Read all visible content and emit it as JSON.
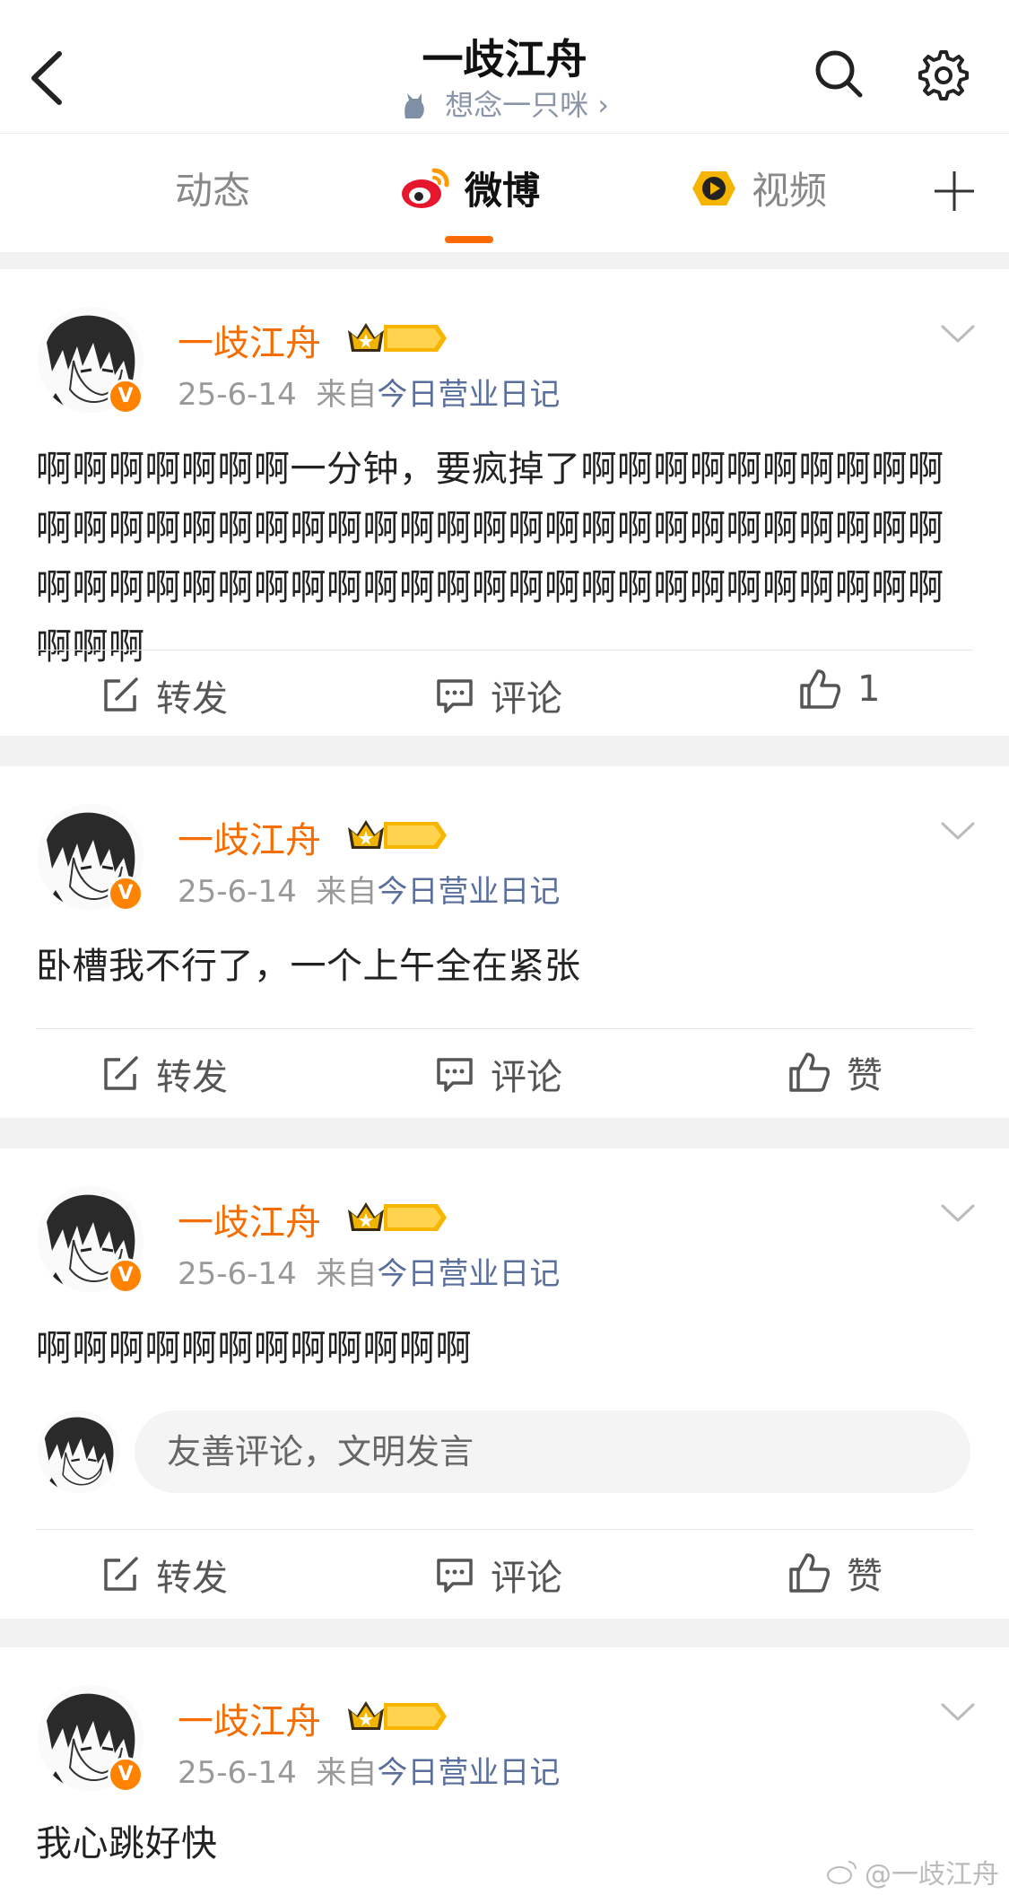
{
  "header": {
    "title": "一歧江舟",
    "subtitle": "想念一只咪 ›"
  },
  "tabs": [
    {
      "label": "动态"
    },
    {
      "label": "微博"
    },
    {
      "label": "视频"
    }
  ],
  "posts": [
    {
      "username": "一歧江舟",
      "date": "25-6-14",
      "from": "来自",
      "source": "今日营业日记",
      "text": "啊啊啊啊啊啊啊一分钟，要疯掉了啊啊啊啊啊啊啊啊啊啊啊啊啊啊啊啊啊啊啊啊啊啊啊啊啊啊啊啊啊啊啊啊啊啊啊啊啊啊啊啊啊啊啊啊啊啊啊啊啊啊啊啊啊啊啊啊啊啊啊啊啊啊啊",
      "repost": "转发",
      "comment": "评论",
      "like": "1"
    },
    {
      "username": "一歧江舟",
      "date": "25-6-14",
      "from": "来自",
      "source": "今日营业日记",
      "text": "卧槽我不行了，一个上午全在紧张",
      "repost": "转发",
      "comment": "评论",
      "like": "赞"
    },
    {
      "username": "一歧江舟",
      "date": "25-6-14",
      "from": "来自",
      "source": "今日营业日记",
      "text": "啊啊啊啊啊啊啊啊啊啊啊啊",
      "comment_placeholder": "友善评论，文明发言",
      "repost": "转发",
      "comment": "评论",
      "like": "赞"
    },
    {
      "username": "一歧江舟",
      "date": "25-6-14",
      "from": "来自",
      "source": "今日营业日记",
      "text": "我心跳好快"
    }
  ],
  "badge": {
    "level": "I",
    "verified": "V"
  },
  "watermark": "@一歧江舟",
  "colors": {
    "accent": "#ff6a00",
    "username": "#f56c00",
    "source": "#5b6f9c"
  }
}
